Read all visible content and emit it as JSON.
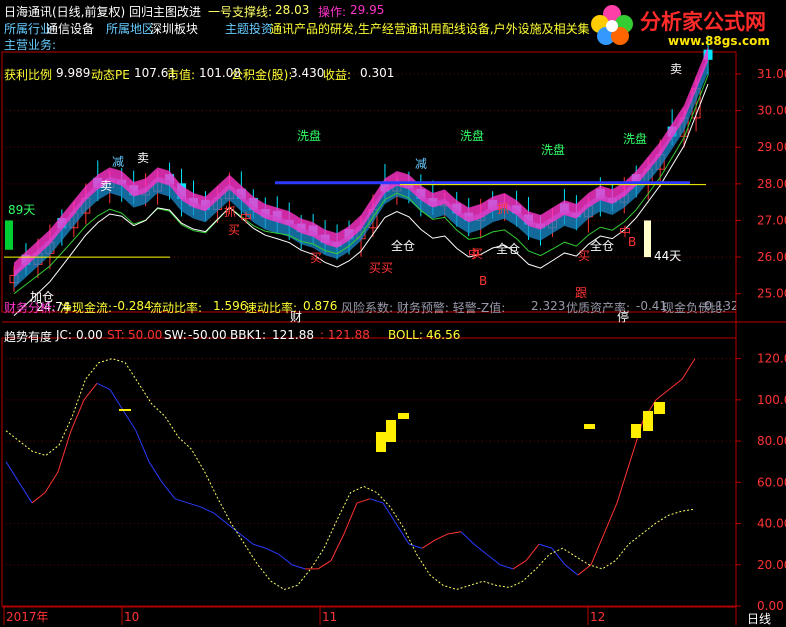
{
  "header": {
    "title": "日海通讯(日线,前复权) 回归主图改进",
    "support_label": "一号支撑线:",
    "support_value": "28.03",
    "operation_label": "操作:",
    "operation_value": "29.95",
    "industry_label": "所属行业",
    "industry_value": "通信设备",
    "region_label": "所属地区",
    "region_value": "深圳板块",
    "theme_label": "主题投资",
    "theme_value": "通讯产品的研发,生产经营通讯用配线设备,户外设施及相关集",
    "business_label": "主营业务:"
  },
  "watermark": {
    "name": "分析家公式网",
    "url": "www.88gs.com"
  },
  "info_line": {
    "pe_profit_label": "获利比例",
    "pe_profit_value": "9.989",
    "dyn_pe_label": "动态PE",
    "dyn_pe_value": "107.61",
    "market_value_label": "市值:",
    "market_value_value": "101.08",
    "fund_label": "公积金(股):",
    "fund_value": "3.430",
    "income_label": "收益:",
    "income_value": "0.301"
  },
  "main_panel": {
    "y_ticks": [
      "31.00",
      "30.00",
      "29.00",
      "28.00",
      "27.00",
      "26.00",
      "25.00"
    ],
    "markers": [
      {
        "text": "卖",
        "color": "#ffffff",
        "kind": "sell1"
      },
      {
        "text": "卖",
        "color": "#ffffff",
        "kind": "sell2"
      },
      {
        "text": "卖",
        "color": "#ffffff",
        "kind": "sell3"
      },
      {
        "text": "减",
        "color": "#66ccff",
        "kind": "reduce1"
      },
      {
        "text": "减",
        "color": "#66ccff",
        "kind": "reduce2"
      },
      {
        "text": "洗盘",
        "color": "#33ff66",
        "kind": "wash1"
      },
      {
        "text": "洗盘",
        "color": "#33ff66",
        "kind": "wash2"
      },
      {
        "text": "洗盘",
        "color": "#33ff66",
        "kind": "wash3"
      },
      {
        "text": "洗盘",
        "color": "#33ff66",
        "kind": "wash4"
      },
      {
        "text": "89天",
        "color": "#33ff66",
        "kind": "days89"
      },
      {
        "text": "44天",
        "color": "#ffffff",
        "kind": "days44"
      },
      {
        "text": "24.74",
        "color": "#ffffff",
        "kind": "low"
      },
      {
        "text": "加仓",
        "color": "#ffffff",
        "kind": "add1"
      },
      {
        "text": "全仓",
        "color": "#ffffff",
        "kind": "full1"
      },
      {
        "text": "全仓",
        "color": "#ffffff",
        "kind": "full2"
      },
      {
        "text": "全仓",
        "color": "#ffffff",
        "kind": "full3"
      },
      {
        "text": "买",
        "color": "#ff3333",
        "kind": "buy1"
      },
      {
        "text": "买",
        "color": "#ff3333",
        "kind": "buy2"
      },
      {
        "text": "买买",
        "color": "#ff3333",
        "kind": "buy3"
      },
      {
        "text": "买",
        "color": "#ff3333",
        "kind": "buy4"
      },
      {
        "text": "买",
        "color": "#ff3333",
        "kind": "buy5"
      },
      {
        "text": "中",
        "color": "#ff3333",
        "kind": "mid1"
      },
      {
        "text": "中",
        "color": "#ff3333",
        "kind": "mid2"
      },
      {
        "text": "中",
        "color": "#ff3333",
        "kind": "mid3"
      },
      {
        "text": "抓",
        "color": "#ff3333",
        "kind": "grab1"
      },
      {
        "text": "抓",
        "color": "#ff3333",
        "kind": "grab2"
      },
      {
        "text": "B",
        "color": "#ff3333",
        "kind": "b1"
      },
      {
        "text": "B",
        "color": "#ff3333",
        "kind": "b2"
      },
      {
        "text": "跟",
        "color": "#ff3333",
        "kind": "follow"
      },
      {
        "text": "财",
        "color": "#ffffff",
        "kind": "fin"
      },
      {
        "text": "停",
        "color": "#ffffff",
        "kind": "stop"
      }
    ],
    "footer": {
      "finance_label": "财务分析:",
      "cash_label": "净现金流:",
      "cash_value": "-0.284",
      "liquidity_label": "流动比率:",
      "liquidity_value": "1.596",
      "quick_label": "速动比率:",
      "quick_value": "0.876",
      "risk_label": "风险系数: 财务预警: 轻警-Z值:",
      "risk_value": "2.323",
      "asset_label": "优质资产率:",
      "asset_value": "-0.41",
      "debt_label": "现金负债比:",
      "debt_value": "-0.132"
    }
  },
  "sub_panel": {
    "title": "趋势有度",
    "jc_label": "JC:",
    "jc_value": "0.00",
    "st_label": "ST:",
    "st_value": "50.00",
    "sw_label": "SW:",
    "sw_value": "-50.00",
    "bbk_label": "BBK1:",
    "bbk_value": "121.88",
    "bbk2_value": ": 121.88",
    "boll_label": "BOLL:",
    "boll_value": "46.56",
    "y_ticks": [
      "120.0",
      "100.0",
      "80.00",
      "60.00",
      "40.00",
      "20.00",
      "0.00"
    ]
  },
  "x_axis": {
    "labels": [
      "2017年",
      "10",
      "11",
      "12"
    ],
    "period": "日线"
  },
  "colors": {
    "up": "#ff3333",
    "down": "#00e5ff",
    "band": "#ff33cc",
    "band2": "#1a8ccc",
    "grid": "#660000",
    "axis": "#b80000",
    "yellow": "#ffff00",
    "blue": "#2a3bff"
  },
  "chart_data": [
    {
      "type": "candlestick",
      "title": "日海通讯(日线,前复权)",
      "ylim": [
        24.5,
        31.6
      ],
      "close": [
        25.5,
        25.8,
        26.1,
        26.4,
        26.8,
        27.2,
        27.6,
        27.9,
        28.1,
        28.0,
        27.7,
        27.8,
        28.1,
        28.0,
        27.6,
        27.4,
        27.3,
        27.6,
        27.9,
        27.6,
        27.3,
        27.1,
        27.0,
        26.9,
        26.7,
        26.6,
        26.4,
        26.3,
        26.5,
        26.8,
        27.3,
        27.8,
        28.0,
        27.9,
        27.6,
        27.4,
        27.5,
        27.2,
        27.0,
        27.1,
        27.3,
        27.4,
        27.2,
        26.9,
        26.8,
        27.0,
        27.2,
        27.1,
        27.4,
        27.6,
        27.5,
        27.7,
        28.0,
        28.4,
        28.8,
        29.3,
        29.8,
        30.6,
        31.4
      ],
      "boll_line": [
        26.0,
        26.0,
        26.0,
        26.0,
        26.0
      ]
    },
    {
      "type": "line",
      "title": "趋势有度",
      "ylim": [
        0,
        130
      ],
      "series": [
        {
          "name": "JC",
          "values": [
            70,
            60,
            50,
            55,
            65,
            85,
            100,
            108,
            105,
            95,
            85,
            70,
            60,
            52,
            50,
            48,
            45,
            40,
            35,
            30,
            28,
            25,
            20,
            18,
            18,
            22,
            35,
            50,
            52,
            50,
            40,
            30,
            28,
            32,
            35,
            36,
            30,
            25,
            20,
            18,
            22,
            30,
            28,
            20,
            15,
            20,
            35,
            50,
            70,
            90,
            100,
            105,
            110,
            120
          ]
        },
        {
          "name": "BOLL",
          "values": [
            85,
            80,
            75,
            73,
            78,
            92,
            110,
            118,
            120,
            118,
            108,
            98,
            92,
            82,
            76,
            65,
            52,
            40,
            30,
            20,
            12,
            8,
            10,
            18,
            28,
            42,
            55,
            58,
            55,
            48,
            38,
            25,
            15,
            10,
            8,
            10,
            12,
            10,
            9,
            12,
            18,
            25,
            28,
            24,
            20,
            18,
            22,
            30,
            35,
            40,
            44,
            46,
            47
          ]
        }
      ]
    }
  ]
}
